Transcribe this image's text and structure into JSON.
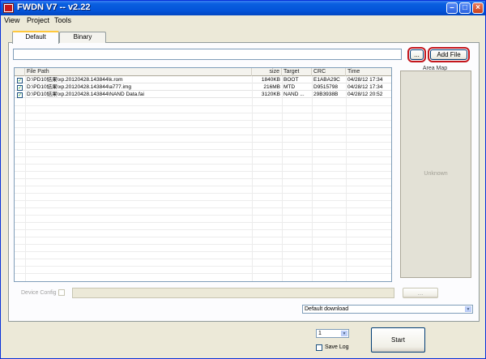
{
  "window": {
    "title": "FWDN V7 -- v2.22"
  },
  "menu": [
    "View",
    "Project",
    "Tools"
  ],
  "tabs": [
    {
      "label": "Default",
      "active": true
    },
    {
      "label": "Binary",
      "active": false
    }
  ],
  "toolbar": {
    "path_value": "",
    "browse_label": "...",
    "add_file_label": "Add File"
  },
  "table": {
    "columns": [
      "File Path",
      "size",
      "Target",
      "CRC",
      "Time"
    ],
    "rows": [
      {
        "checked": true,
        "path": "D:\\PD10結果\\xp.20120428.143844\\k.rom",
        "size": "1840KB",
        "target": "BOOT",
        "crc": "E1ABA29C",
        "time": "04/28/12 17:34"
      },
      {
        "checked": true,
        "path": "D:\\PD10結果\\xp.20120428.143844\\a777.img",
        "size": "216MB",
        "target": "MTD",
        "crc": "D9515798",
        "time": "04/28/12 17:34"
      },
      {
        "checked": true,
        "path": "D:\\PD10結果\\xp.20120428.143844\\NAND Data.fai",
        "size": "3120KB",
        "target": "NAND ...",
        "crc": "29B3938B",
        "time": "04/28/12 20:52"
      }
    ]
  },
  "area_map": {
    "title": "Area Map",
    "status": "Unknown"
  },
  "device_config": {
    "label": "Device Config",
    "browse_label": "..."
  },
  "download_mode": {
    "value": "Default download"
  },
  "count_select": {
    "value": "1"
  },
  "save_log": {
    "label": "Save Log",
    "checked": false
  },
  "start": {
    "label": "Start"
  },
  "colors": {
    "title_bar": "#0353d8",
    "highlight": "#c4161c",
    "check_mark": "#21a121"
  }
}
